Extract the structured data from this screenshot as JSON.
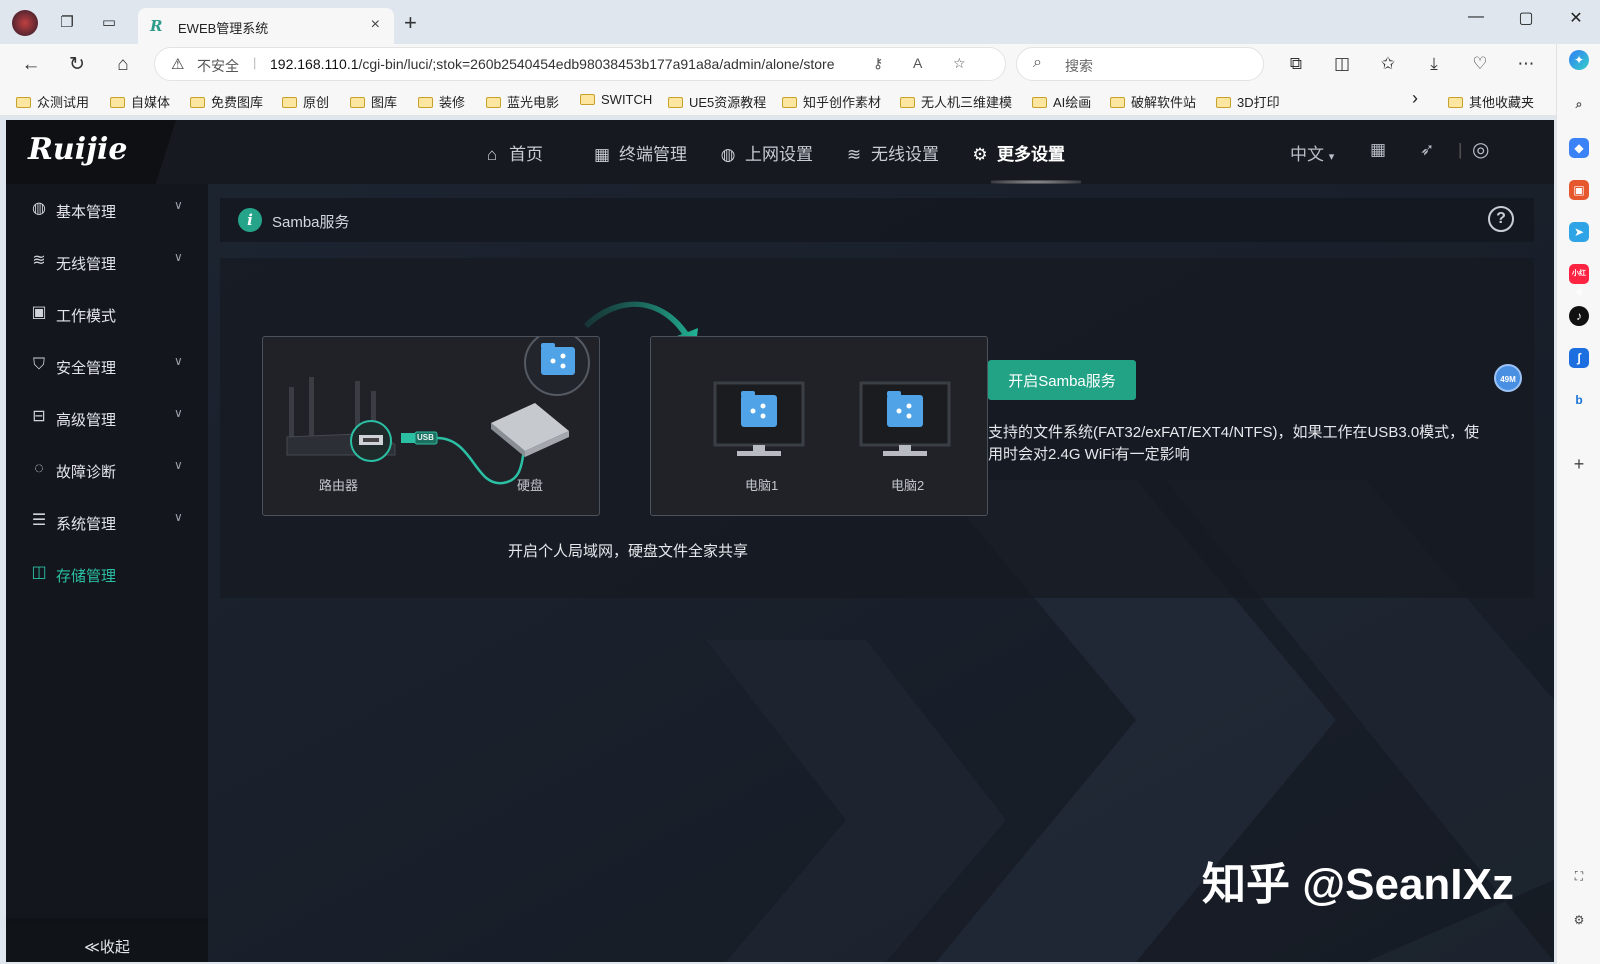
{
  "browser": {
    "tab_title": "EWEB管理系统",
    "tab_close": "×",
    "new_tab": "+",
    "security_label": "不安全",
    "url_host": "192.168.110.1",
    "url_path": "/cgi-bin/luci/;stok=260b2540454edb98038453b177a91a8a/admin/alone/store",
    "search_placeholder": "搜索",
    "bookmarks": [
      "众测试用",
      "自媒体",
      "免费图库",
      "原创",
      "图库",
      "装修",
      "蓝光电影",
      "SWITCH",
      "UE5资源教程",
      "知乎创作素材",
      "无人机三维建模",
      "AI绘画",
      "破解软件站",
      "3D打印"
    ],
    "bookmarks_more": "›",
    "other_bookmarks": "其他收藏夹",
    "badge": "49M"
  },
  "app": {
    "logo": "Ruijie",
    "nav": [
      {
        "label": "首页",
        "icon": "home-icon"
      },
      {
        "label": "终端管理",
        "icon": "grid-icon"
      },
      {
        "label": "上网设置",
        "icon": "globe-icon"
      },
      {
        "label": "无线设置",
        "icon": "wifi-icon"
      },
      {
        "label": "更多设置",
        "icon": "gear-icon"
      }
    ],
    "language": "中文",
    "sidebar": [
      {
        "label": "基本管理",
        "icon": "globe-icon"
      },
      {
        "label": "无线管理",
        "icon": "wifi-icon"
      },
      {
        "label": "工作模式",
        "icon": "mode-icon"
      },
      {
        "label": "安全管理",
        "icon": "shield-icon"
      },
      {
        "label": "高级管理",
        "icon": "toolbox-icon"
      },
      {
        "label": "故障诊断",
        "icon": "diagnose-icon"
      },
      {
        "label": "系统管理",
        "icon": "sliders-icon"
      },
      {
        "label": "存储管理",
        "icon": "storage-icon"
      }
    ],
    "collapse_label": "≪收起",
    "breadcrumb": "Samba服务",
    "illustration": {
      "router_label": "路由器",
      "disk_label": "硬盘",
      "pc1_label": "电脑1",
      "pc2_label": "电脑2",
      "usb_label": "USB"
    },
    "caption": "开启个人局域网，硬盘文件全家共享",
    "samba_button": "开启Samba服务",
    "samba_desc": "支持的文件系统(FAT32/exFAT/EXT4/NTFS)，如果工作在USB3.0模式，使用时会对2.4G WiFi有一定影响",
    "accent_color": "#22a386"
  },
  "watermark": "知乎 @SeanIXz"
}
